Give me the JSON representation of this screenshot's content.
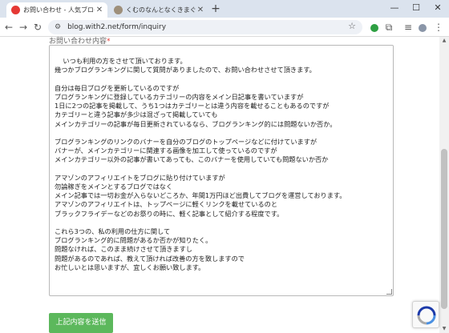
{
  "browser": {
    "tabs": [
      {
        "title": "お問い合わせ - 人気ブログランキング",
        "active": true
      },
      {
        "title": "くむのなんとなくきまぐれに。- 自由",
        "active": false
      }
    ],
    "new_tab_label": "+",
    "url": "blog.with2.net/form/inquiry",
    "window_controls": {
      "minimize": "—",
      "maximize": "☐",
      "close": "✕"
    }
  },
  "form": {
    "label": "お問い合わせ内容",
    "required_mark": "*",
    "message": "いつも利用の方をさせて頂いております。\n幾つかブログランキングに関して質問がありましたので、お問い合わせさせて頂きます。\n\n自分は毎日ブログを更新しているのですが\nブログランキングに登録しているカテゴリーの内容をメイン日記事を書いていますが\n1日に2つの記事を掲載して、うち1つはカテゴリーとは違う内容を載せることもあるのですが\nカテゴリーと違う記事が多少は混ざって掲載していても\nメインカテゴリーの記事が毎日更新されているなら、ブログランキング的には問題ないか否か。\n\nブログランキングのリンクのバナーを自分のブログのトップページなどに付けていますが\nバナーが、メインカテゴリーに関連する画像を加工して使っているのですが\nメインカテゴリー以外の記事が書いてあっても、このバナーを使用していても問題ないか否か\n\nアマゾンのアフィリエイトをブログに貼り付けていますが\n勿論稼ぎをメインとするブログではなく\nメイン記事では一切お金が入らないどころか、年間1万円ほど出費してブログを運営しております。\nアマゾンのアフィリエイトは、トップページに軽くリンクを載せているのと\nブラックフライデーなどのお祭りの時に、軽く記事として紹介する程度です。\n\nこれら3つの、私の利用の仕方に関して\nブログランキング的に問題があるか否かが知りたく。\n問題なければ、このまま続けさせて頂きますし\n問題があるのであれば、教えて頂ければ改善の方を致しますので\nお忙しいとは思いますが、宜しくお願い致します。",
    "submit_label": "上記内容を送信"
  },
  "colors": {
    "submit": "#5cb85c",
    "required": "#e53935"
  }
}
